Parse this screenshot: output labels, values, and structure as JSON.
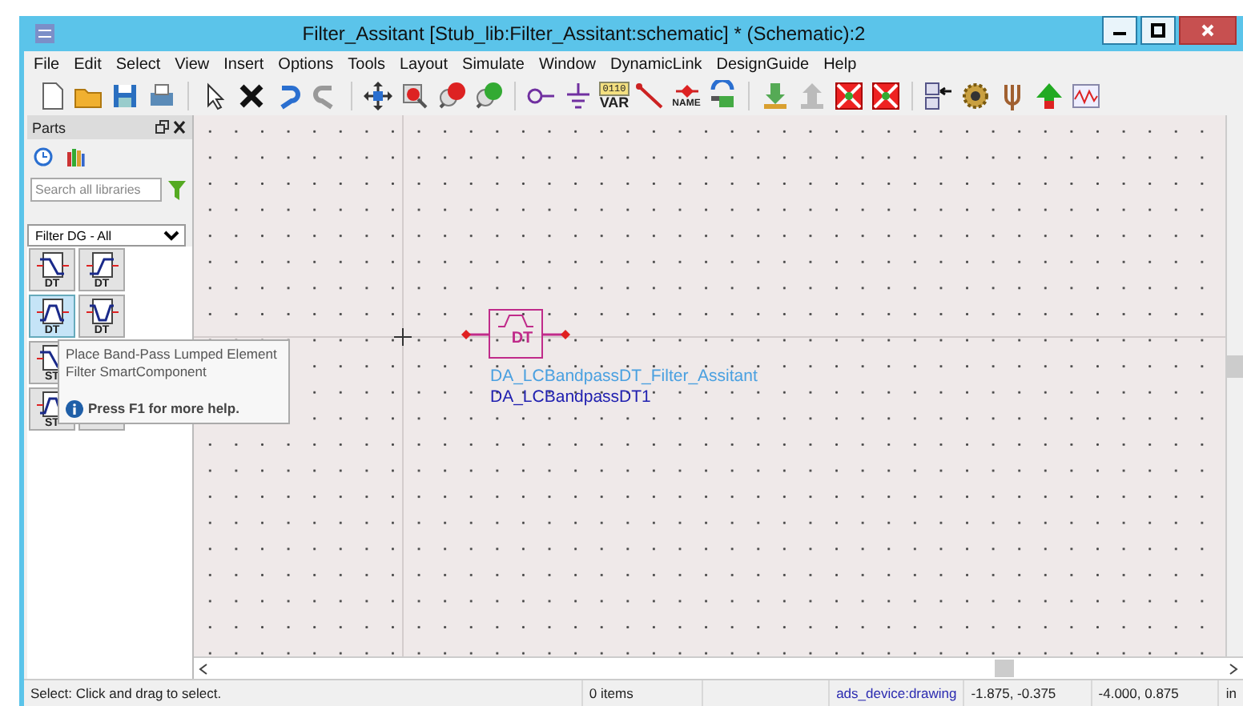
{
  "window": {
    "title": "Filter_Assitant [Stub_lib:Filter_Assitant:schematic] * (Schematic):2"
  },
  "menu": [
    "File",
    "Edit",
    "Select",
    "View",
    "Insert",
    "Options",
    "Tools",
    "Layout",
    "Simulate",
    "Window",
    "DynamicLink",
    "DesignGuide",
    "Help"
  ],
  "toolbar": [
    {
      "kind": "new"
    },
    {
      "kind": "open"
    },
    {
      "kind": "save"
    },
    {
      "kind": "print"
    },
    {
      "kind": "sep"
    },
    {
      "kind": "pointer"
    },
    {
      "kind": "delete"
    },
    {
      "kind": "undo"
    },
    {
      "kind": "redo"
    },
    {
      "kind": "sep"
    },
    {
      "kind": "move"
    },
    {
      "kind": "zoom"
    },
    {
      "kind": "zoomin"
    },
    {
      "kind": "zoomout"
    },
    {
      "kind": "sep"
    },
    {
      "kind": "port"
    },
    {
      "kind": "ground"
    },
    {
      "kind": "var",
      "caption": "0110",
      "label": "VAR"
    },
    {
      "kind": "wire"
    },
    {
      "kind": "name",
      "label": "NAME"
    },
    {
      "kind": "swap"
    },
    {
      "kind": "sep"
    },
    {
      "kind": "push"
    },
    {
      "kind": "pop"
    },
    {
      "kind": "redx"
    },
    {
      "kind": "redx"
    },
    {
      "kind": "sep"
    },
    {
      "kind": "list"
    },
    {
      "kind": "gear"
    },
    {
      "kind": "tuning"
    },
    {
      "kind": "arrow"
    },
    {
      "kind": "graph"
    }
  ],
  "parts": {
    "title": "Parts",
    "search": {
      "placeholder": "Search all libraries"
    },
    "library": "Filter DG - All",
    "items": [
      {
        "kind": "lowpass",
        "label": "DT",
        "selected": false
      },
      {
        "kind": "highpass",
        "label": "DT",
        "selected": false
      },
      {
        "kind": "bandpass",
        "label": "DT",
        "selected": true
      },
      {
        "kind": "bandstop",
        "label": "DT",
        "selected": false
      },
      {
        "kind": "lowpass",
        "label": "ST",
        "selected": false
      },
      {
        "kind": "hidden"
      },
      {
        "kind": "bandpass",
        "label": "ST",
        "selected": false
      },
      {
        "kind": "hidden"
      }
    ],
    "tooltip": {
      "lines": [
        "Place Band-Pass Lumped Element",
        "Filter SmartComponent"
      ],
      "help": "Press F1 for more help."
    }
  },
  "canvas": {
    "component": {
      "label": "DT",
      "name": "DA_LCBandpassDT_Filter_Assitant",
      "instance": "DA_LCBandpassDT1"
    }
  },
  "status_bar": {
    "message": "Select: Click and drag to select.",
    "items": "0 items",
    "layer": "ads_device:drawing",
    "cursor": "-1.875, -0.375",
    "position": "-4.000, 0.875",
    "units": "in"
  }
}
